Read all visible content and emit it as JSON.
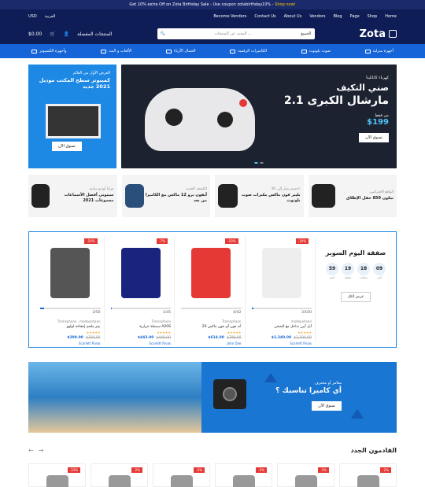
{
  "topbar": {
    "text": "Get 10% extra Off on Zota Birthday Sale - Use coupon zotabirthday10% -",
    "link": "Shop now!"
  },
  "nav": {
    "left": [
      "Home",
      "Shop",
      "Page",
      "Blog",
      "Vendors",
      "About Us",
      "Contact Us",
      "Become Vendors"
    ],
    "lang": "العربية",
    "currency": "USD"
  },
  "header": {
    "logo": "Zota",
    "search_placeholder": "البحث عن المنتجات ...",
    "search_category": "الجميع",
    "wishlist": "المنتجات المفضلة",
    "cart_amount": "$0.00"
  },
  "categories": [
    "أجهزة منزلية",
    "صوت بلوتوث",
    "الكاميرات الرقمية",
    "الجمال الأزياء",
    "الألعاب و البث",
    "وأجهزة الكمبيوتر"
  ],
  "hero": {
    "pre": "كهرباء كاتاتلينا",
    "t1": "صني التكيف",
    "t2": "مارشال الكبرى 2.1",
    "from": "من فقط",
    "price": "$199",
    "btn": "تسوق الآن"
  },
  "promo": {
    "pre": "العرض الأول من العالم",
    "t": "كمبيوتر سطح المكتب موديل 2021 جديد",
    "btn": "تسوق الآن"
  },
  "minis": [
    {
      "s": "مزايا أوديو سانيه",
      "b": "سيتوني أفضل الأسماعات مجموعات 2021"
    },
    {
      "s": "الكشف الجديد",
      "b": "آيفون برو 12 ماكس مع الكاميرا من بعد"
    },
    {
      "s": "خصم يصل إلى 30٪",
      "b": "بليتر فون ماكس مكبرات صوت بلوتوث"
    },
    {
      "s": "الواقع الافتراضي",
      "b": "نيكون 850 حقل الإطلاق"
    }
  ],
  "deal": {
    "title": "صفقة اليوم السوبر",
    "timer": [
      {
        "n": "09",
        "l": "أيام"
      },
      {
        "n": "18",
        "l": "ساعات"
      },
      {
        "n": "19",
        "l": "دقيقة"
      },
      {
        "n": "59",
        "l": "ثانية"
      }
    ],
    "btn": "عرض الكل",
    "products": [
      {
        "disc": "-10%",
        "stock": "3/50",
        "fill": 0.06,
        "vendor": "Tramsphaan · madepohaan",
        "name": "بيتز ملحم إنتفاخة لولوو",
        "price_old": "$300.00",
        "price_new": "$290.00",
        "seller": "Scarlett Rivas"
      },
      {
        "disc": "-7%",
        "stock": "1/45",
        "fill": 0.02,
        "vendor": "Tramsphaan",
        "name": "سبتملة جزارية A20S",
        "price_old": "$449.00",
        "price_new": "$443.00",
        "seller": "Scarlett Rivas"
      },
      {
        "disc": "-10%",
        "stock": "0/42",
        "fill": 0,
        "vendor": "Tramsphaan",
        "name": "أند فون آي فون ماكس 20",
        "price_old": "$799.00",
        "price_new": "$614.00",
        "seller": "John Doe"
      },
      {
        "disc": "-10%",
        "stock": "3/100",
        "fill": 0.03,
        "vendor": "madepohaan",
        "name": "آبل آيرز تداخل مع الشحن",
        "price_old": "$1,500.00",
        "price_new": "$1,340.00",
        "seller": "Scarlett Rivas"
      }
    ]
  },
  "banner": {
    "pre": "مغامر أو محترف",
    "t": "أي كاميرا تناسبك ؟",
    "btn": "تسوق الآن"
  },
  "new_arrivals": {
    "title": "القادمون الجدد",
    "discs": [
      "-33%",
      "-2%",
      "-2%",
      "-2%",
      "-2%",
      "-2%"
    ]
  }
}
